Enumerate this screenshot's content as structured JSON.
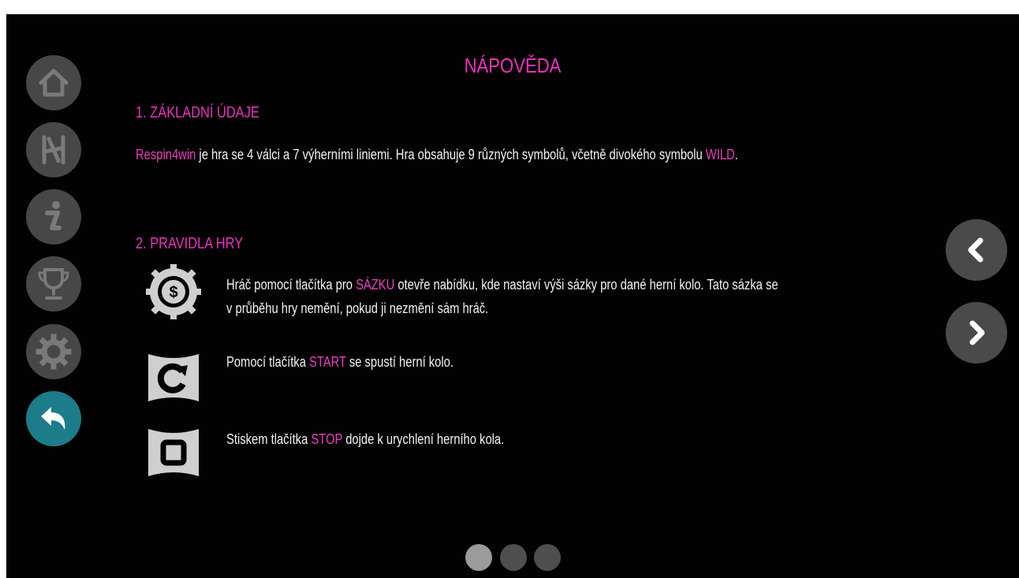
{
  "title": "NÁPOVĚDA",
  "sections": [
    {
      "heading": "1. ZÁKLADNÍ ÚDAJE",
      "text_parts": [
        "Respin4win",
        " je hra se 4 válci a 7 výherními liniemi. Hra obsahuje 9 různých symbolů, včetně divokého symbolu ",
        "WILD",
        "."
      ]
    },
    {
      "heading": "2. PRAVIDLA HRY"
    }
  ],
  "rules": [
    {
      "icon": "bet-coin-icon",
      "line1_parts": [
        "Hráč pomocí tlačítka pro ",
        "SÁZKU",
        " otevře nabídku, kde nastaví výši sázky pro dané herní kolo. Tato sázka se"
      ],
      "line2": "v průběhu hry nemění, pokud ji nezmění sám hráč."
    },
    {
      "icon": "start-spin-icon",
      "line1_parts": [
        "Pomocí tlačítka ",
        "START",
        " se spustí herní kolo."
      ]
    },
    {
      "icon": "stop-icon",
      "line1_parts": [
        "Stiskem tlačítka ",
        "STOP",
        " dojde k urychlení herního kola."
      ]
    }
  ],
  "sidebar": [
    {
      "icon": "home-icon"
    },
    {
      "icon": "paylines-icon"
    },
    {
      "icon": "info-icon"
    },
    {
      "icon": "trophy-icon"
    },
    {
      "icon": "gear-icon"
    },
    {
      "icon": "back-arrow-icon"
    }
  ],
  "pager": {
    "pages": 3,
    "current": 1
  },
  "colors": {
    "accent": "#ee2fc0",
    "background": "#020202",
    "button": "#474747",
    "back_button": "#1c7c89",
    "text": "#f2f2f2"
  }
}
